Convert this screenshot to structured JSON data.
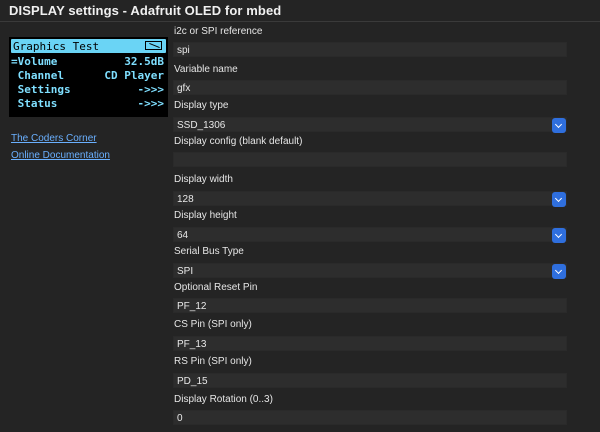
{
  "window": {
    "title": "DISPLAY settings - Adafruit OLED for mbed"
  },
  "preview": {
    "header": "Graphics Test",
    "rows": [
      {
        "left": "=Volume",
        "right": "32.5dB"
      },
      {
        "left": " Channel",
        "right": "CD Player"
      },
      {
        "left": " Settings",
        "right": "->>>"
      },
      {
        "left": " Status",
        "right": "->>>"
      }
    ]
  },
  "links": {
    "coders_corner": "The Coders Corner",
    "docs": "Online Documentation"
  },
  "form": {
    "i2c_spi_ref": {
      "label": "i2c or SPI reference",
      "value": "spi"
    },
    "variable_name": {
      "label": "Variable name",
      "value": "gfx"
    },
    "display_type": {
      "label": "Display type",
      "value": "SSD_1306"
    },
    "display_config": {
      "label": "Display config (blank default)",
      "value": ""
    },
    "display_width": {
      "label": "Display width",
      "value": "128"
    },
    "display_height": {
      "label": "Display height",
      "value": "64"
    },
    "serial_bus_type": {
      "label": "Serial Bus Type",
      "value": "SPI"
    },
    "reset_pin": {
      "label": "Optional Reset Pin",
      "value": "PF_12"
    },
    "cs_pin": {
      "label": "CS Pin (SPI only)",
      "value": "PF_13"
    },
    "rs_pin": {
      "label": "RS Pin (SPI only)",
      "value": "PD_15"
    },
    "rotation": {
      "label": "Display Rotation (0..3)",
      "value": "0"
    }
  }
}
